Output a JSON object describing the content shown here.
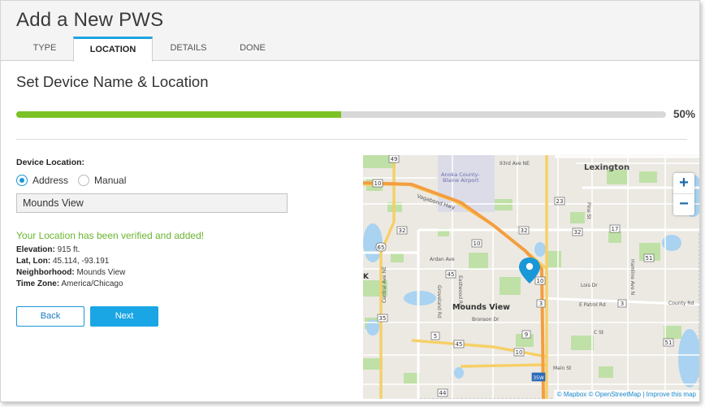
{
  "page": {
    "title": "Add a New PWS"
  },
  "tabs": [
    {
      "label": "TYPE",
      "active": false
    },
    {
      "label": "LOCATION",
      "active": true
    },
    {
      "label": "DETAILS",
      "active": false
    },
    {
      "label": "DONE",
      "active": false
    }
  ],
  "section": {
    "title": "Set Device Name & Location"
  },
  "progress": {
    "value": 0.5,
    "label": "50%",
    "fill_color": "#7ac226"
  },
  "location": {
    "label": "Device Location:",
    "options": [
      {
        "label": "Address",
        "selected": true
      },
      {
        "label": "Manual",
        "selected": false
      }
    ],
    "input_value": "Mounds View"
  },
  "verification": {
    "message": "Your Location has been verified and added!",
    "color": "#69b530",
    "fields": [
      {
        "key": "Elevation:",
        "value": "915 ft."
      },
      {
        "key": "Lat, Lon:",
        "value": "45.114, -93.191"
      },
      {
        "key": "Neighborhood:",
        "value": "Mounds View"
      },
      {
        "key": "Time Zone:",
        "value": "America/Chicago"
      }
    ]
  },
  "buttons": {
    "back": "Back",
    "next": "Next",
    "accent": "#1aa6e4"
  },
  "map": {
    "labels": {
      "lexington": "Lexington",
      "airport_1": "Anoka County-",
      "airport_2": "Blaine Airport",
      "ave93": "93rd Ave NE",
      "mounds_view": "Mounds View",
      "ardan": "Ardan Ave",
      "central": "Central Ave NE",
      "eastwood": "Eastwood Rd",
      "groveland": "Groveland Rd",
      "bronson": "Bronson Dr",
      "lois": "Lois Dr",
      "epatrol": "E Patrol Rd",
      "cst": "C St",
      "mainst": "Main St",
      "county": "County Rd",
      "hamline": "Hamline Ave N",
      "pine": "Pine St",
      "vaughn": "Vagabond Hwy",
      "highway_k": "K",
      "r10a": "10",
      "r10b": "10",
      "r10c": "10",
      "r10d": "10",
      "r65": "65",
      "r49": "49",
      "r23": "23",
      "r32a": "32",
      "r32b": "32",
      "r32c": "32",
      "r17": "17",
      "r51a": "51",
      "r51b": "51",
      "r45a": "45",
      "r45b": "45",
      "r3a": "3",
      "r3b": "3",
      "r5": "5",
      "r9": "9",
      "r35": "35",
      "r44": "44",
      "i35w": "35W"
    },
    "zoom_in": "+",
    "zoom_out": "−",
    "attribution": "© Mapbox © OpenStreetMap | Improve this map",
    "marker_color": "#1a97d6"
  }
}
